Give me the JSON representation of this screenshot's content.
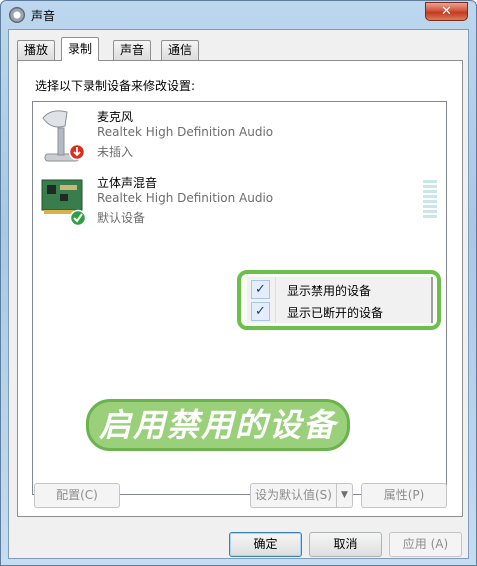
{
  "window": {
    "title": "声音",
    "close_symbol": "✕"
  },
  "tabs": [
    {
      "label": "播放",
      "active": false
    },
    {
      "label": "录制",
      "active": true
    },
    {
      "label": "声音",
      "active": false
    },
    {
      "label": "通信",
      "active": false
    }
  ],
  "panel": {
    "instruction": "选择以下录制设备来修改设置:",
    "devices": [
      {
        "name": "麦克风",
        "driver": "Realtek High Definition Audio",
        "status": "未插入",
        "icon": "microphone-icon",
        "badge": "unplugged-badge-icon"
      },
      {
        "name": "立体声混音",
        "driver": "Realtek High Definition Audio",
        "status": "默认设备",
        "icon": "sound-card-icon",
        "badge": "default-checkmark-icon"
      }
    ],
    "context_menu": {
      "items": [
        {
          "label": "显示禁用的设备",
          "checked": true,
          "check": "✓"
        },
        {
          "label": "显示已断开的设备",
          "checked": true,
          "check": "✓"
        }
      ]
    },
    "annotation": "启用禁用的设备",
    "buttons": {
      "configure": "配置(C)",
      "set_default": "设为默认值(S)",
      "set_default_arrow": "▼",
      "properties": "属性(P)"
    }
  },
  "footer": {
    "ok": "确定",
    "cancel": "取消",
    "apply": "应用 (A)"
  },
  "colors": {
    "highlight_border": "#6cbf4a",
    "annotation_fill": "#9bd07a",
    "unplugged_badge": "#d9301e",
    "default_badge": "#2ea043"
  }
}
